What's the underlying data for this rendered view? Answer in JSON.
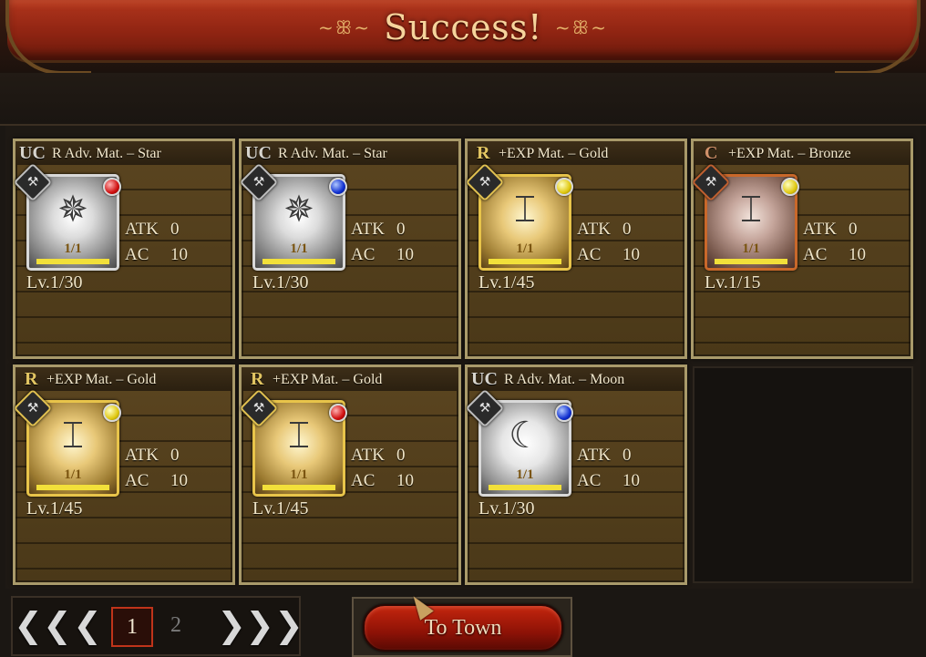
{
  "header": {
    "title": "Success!",
    "flourish_left": "~ꕥ~",
    "flourish_right": "~ꕥ~"
  },
  "colors": {
    "banner": "#9c2a14",
    "gold_text": "#f6d49c",
    "card_border": "#a99a6a",
    "button_red": "#b01e0c",
    "page_active_border": "#c0341a"
  },
  "cards": [
    {
      "rarity": "UC",
      "name": "R Adv. Mat. – Star",
      "count": "1/1",
      "atk_label": "ATK",
      "atk": "0",
      "ac_label": "AC",
      "ac": "10",
      "level": "Lv.1/30",
      "gem": "red",
      "frame": "silver",
      "icon": "star-mace-icon"
    },
    {
      "rarity": "UC",
      "name": "R Adv. Mat. – Star",
      "count": "1/1",
      "atk_label": "ATK",
      "atk": "0",
      "ac_label": "AC",
      "ac": "10",
      "level": "Lv.1/30",
      "gem": "blue",
      "frame": "silver",
      "icon": "star-mace-icon"
    },
    {
      "rarity": "R",
      "name": "+EXP Mat. – Gold",
      "count": "1/1",
      "atk_label": "ATK",
      "atk": "0",
      "ac_label": "AC",
      "ac": "10",
      "level": "Lv.1/45",
      "gem": "yellow",
      "frame": "gold",
      "icon": "anvil-icon"
    },
    {
      "rarity": "C",
      "name": "+EXP Mat. – Bronze",
      "count": "1/1",
      "atk_label": "ATK",
      "atk": "0",
      "ac_label": "AC",
      "ac": "10",
      "level": "Lv.1/15",
      "gem": "yellow",
      "frame": "bronze",
      "icon": "anvil-icon"
    },
    {
      "rarity": "R",
      "name": "+EXP Mat. – Gold",
      "count": "1/1",
      "atk_label": "ATK",
      "atk": "0",
      "ac_label": "AC",
      "ac": "10",
      "level": "Lv.1/45",
      "gem": "yellow",
      "frame": "gold",
      "icon": "anvil-icon"
    },
    {
      "rarity": "R",
      "name": "+EXP Mat. – Gold",
      "count": "1/1",
      "atk_label": "ATK",
      "atk": "0",
      "ac_label": "AC",
      "ac": "10",
      "level": "Lv.1/45",
      "gem": "red",
      "frame": "gold",
      "icon": "anvil-icon"
    },
    {
      "rarity": "UC",
      "name": "R Adv. Mat. – Moon",
      "count": "1/1",
      "atk_label": "ATK",
      "atk": "0",
      "ac_label": "AC",
      "ac": "10",
      "level": "Lv.1/30",
      "gem": "blue",
      "frame": "silver",
      "icon": "moon-mace-icon"
    }
  ],
  "pager": {
    "first_icon": "double-chevron-left-icon",
    "prev_icon": "chevron-left-icon",
    "pages": [
      "1",
      "2"
    ],
    "current_page": "1",
    "next_icon": "chevron-right-icon",
    "last_icon": "double-chevron-right-icon"
  },
  "footer": {
    "town_button": "To Town"
  }
}
